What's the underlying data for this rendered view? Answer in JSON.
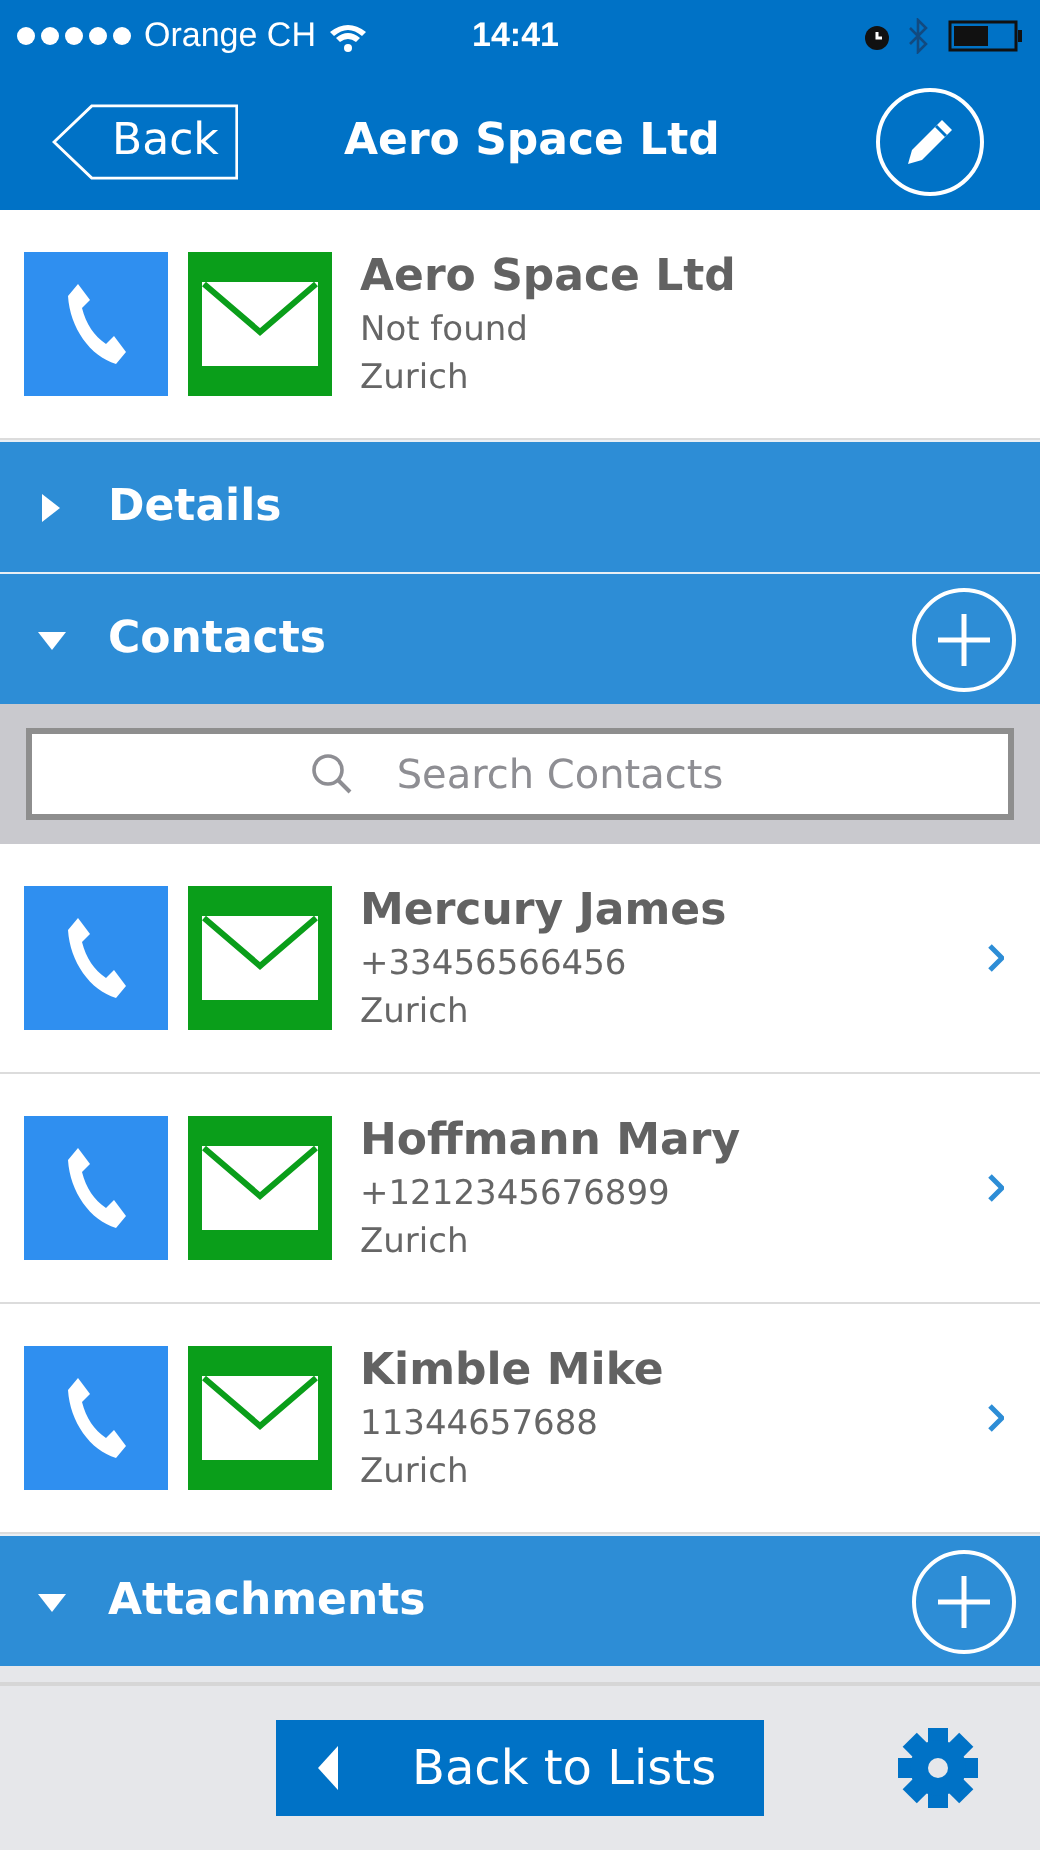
{
  "status_bar": {
    "carrier": "Orange CH",
    "time": "14:41"
  },
  "nav": {
    "back": "Back",
    "title": "Aero Space Ltd"
  },
  "company": {
    "name": "Aero Space Ltd",
    "phone": "Not found",
    "city": "Zurich"
  },
  "sections": [
    {
      "title": "Details",
      "expanded": false,
      "add_button": false
    },
    {
      "title": "Contacts",
      "expanded": true,
      "add_button": true,
      "search": {
        "placeholder": "Search Contacts"
      },
      "contacts": [
        {
          "name": "Mercury James",
          "phone": "+33456566456",
          "city": "Zurich"
        },
        {
          "name": "Hoffmann Mary",
          "phone": "+1212345676899",
          "city": "Zurich"
        },
        {
          "name": "Kimble Mike",
          "phone": "11344657688",
          "city": "Zurich"
        }
      ]
    },
    {
      "title": "Attachments",
      "expanded": true,
      "add_button": true
    }
  ],
  "footer": {
    "button": "Back to Lists"
  }
}
